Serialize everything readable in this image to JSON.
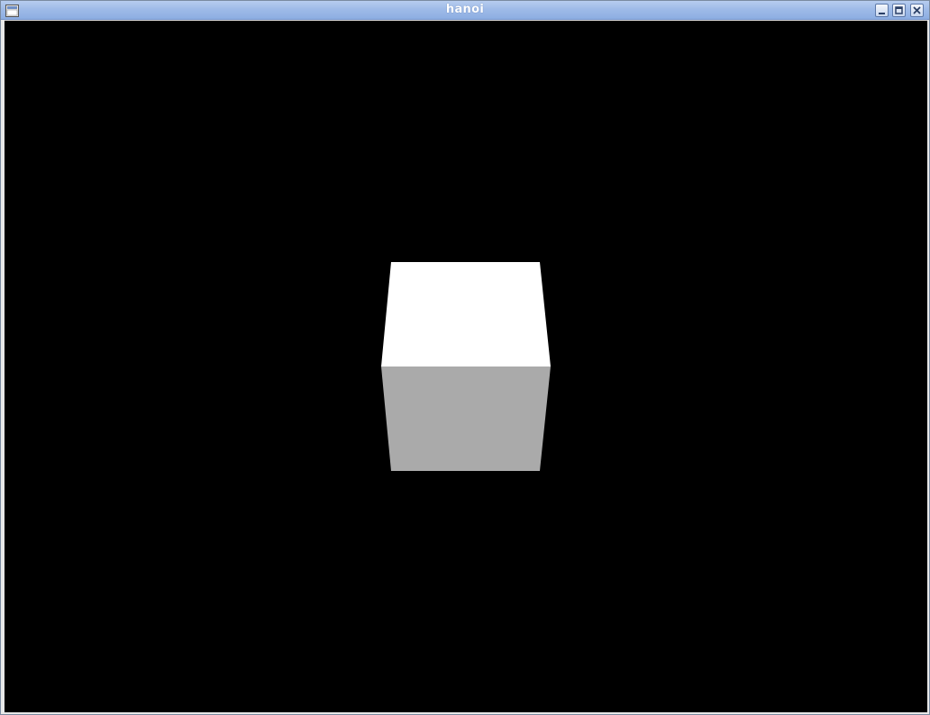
{
  "window": {
    "title": "hanoi",
    "app_icon": "app-window-icon",
    "controls": {
      "minimize_icon": "minimize-icon",
      "maximize_icon": "maximize-icon",
      "close_icon": "close-icon"
    }
  },
  "scene": {
    "background_color": "#000000",
    "cube": {
      "top_face_color": "#ffffff",
      "front_face_color": "#aaaaaa"
    }
  },
  "colors": {
    "titlebar_accent": "#9fbbe8",
    "title_text": "#ffffff"
  }
}
